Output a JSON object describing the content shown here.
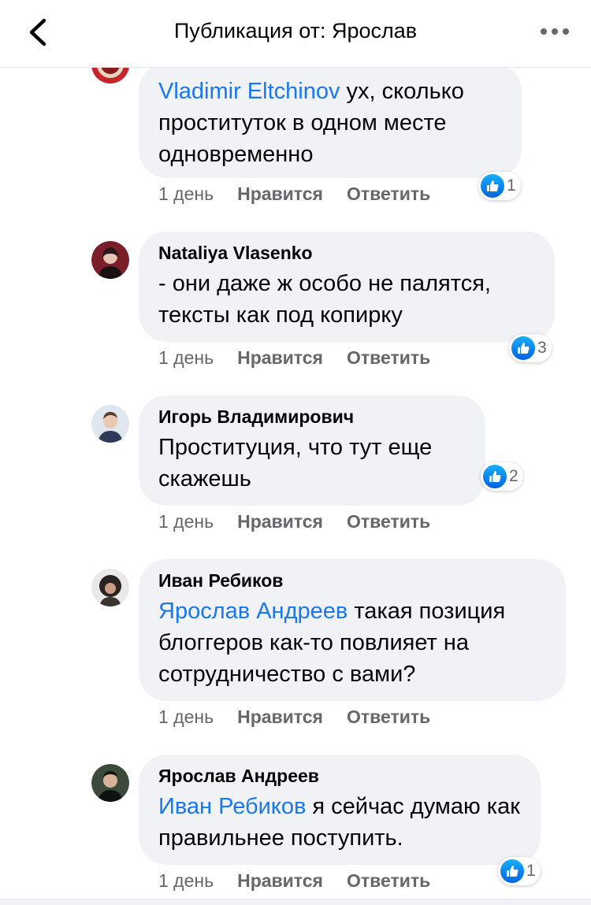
{
  "header": {
    "title": "Публикация от: Ярослав"
  },
  "comments": [
    {
      "mention": "Vladimir Eltchinov",
      "text": " ух, сколько проституток в одном месте одновременно",
      "time": "1 день",
      "like_label": "Нравится",
      "reply_label": "Ответить",
      "reaction_count": "1"
    },
    {
      "author": "Nataliya Vlasenko",
      "text": "- они даже ж особо не палятся, тексты как под копирку",
      "time": "1 день",
      "like_label": "Нравится",
      "reply_label": "Ответить",
      "reaction_count": "3"
    },
    {
      "author": "Игорь Владимирович",
      "text": "Проституция, что тут еще скажешь",
      "time": "1 день",
      "like_label": "Нравится",
      "reply_label": "Ответить",
      "reaction_count": "2"
    },
    {
      "author": "Иван Ребиков",
      "mention": "Ярослав Андреев",
      "text": " такая позиция блоггеров как-то повлияет на сотрудничество с вами?",
      "time": "1 день",
      "like_label": "Нравится",
      "reply_label": "Ответить"
    },
    {
      "author": "Ярослав Андреев",
      "mention": "Иван Ребиков",
      "text": " я сейчас думаю как правильнее поступить.",
      "time": "1 день",
      "like_label": "Нравится",
      "reply_label": "Ответить",
      "reaction_count": "1"
    }
  ],
  "icons": {
    "back": "chevron-left-icon",
    "more": "more-dots-icon",
    "like": "like-thumb-icon"
  },
  "colors": {
    "mention": "#1877f2",
    "bubble": "#f0f2f5",
    "secondary_text": "#65676b",
    "like_gradient_top": "#18afff",
    "like_gradient_bottom": "#0062df"
  }
}
